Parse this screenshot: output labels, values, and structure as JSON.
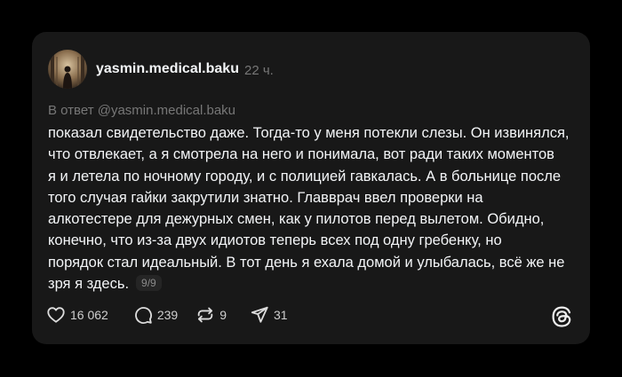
{
  "post": {
    "author": "yasmin.medical.baku",
    "time": "22 ч.",
    "reply_to": "В ответ @yasmin.medical.baku",
    "lines": [
      "показал свидетельство даже. Тогда-то у меня потекли слезы. Он извинялся,",
      "что отвлекает, а я смотрела на него и понимала, вот ради таких моментов",
      "я и летела по ночному городу, и с полицией гавкалась. А в больнице после",
      "того случая гайки закрутили знатно. Главврач ввел проверки на",
      "алкотестере для дежурных смен, как у пилотов перед вылетом. Обидно,",
      "конечно, что из-за двух идиотов теперь всех под одну гребенку, но",
      "порядок стал идеальный. В тот день я ехала домой и улыбалась, всё же не",
      "зря я здесь."
    ],
    "page_badge": "9/9"
  },
  "actions": {
    "likes": "16 062",
    "comments": "239",
    "reposts": "9",
    "shares": "31"
  },
  "icons": {
    "like": "heart-icon",
    "comment": "comment-bubble-icon",
    "repost": "repost-icon",
    "share": "send-icon",
    "brand": "threads-logo-icon"
  },
  "colors": {
    "page_bg": "#000000",
    "card_bg": "#181818",
    "text": "#f3f5f7",
    "muted": "#777777"
  }
}
